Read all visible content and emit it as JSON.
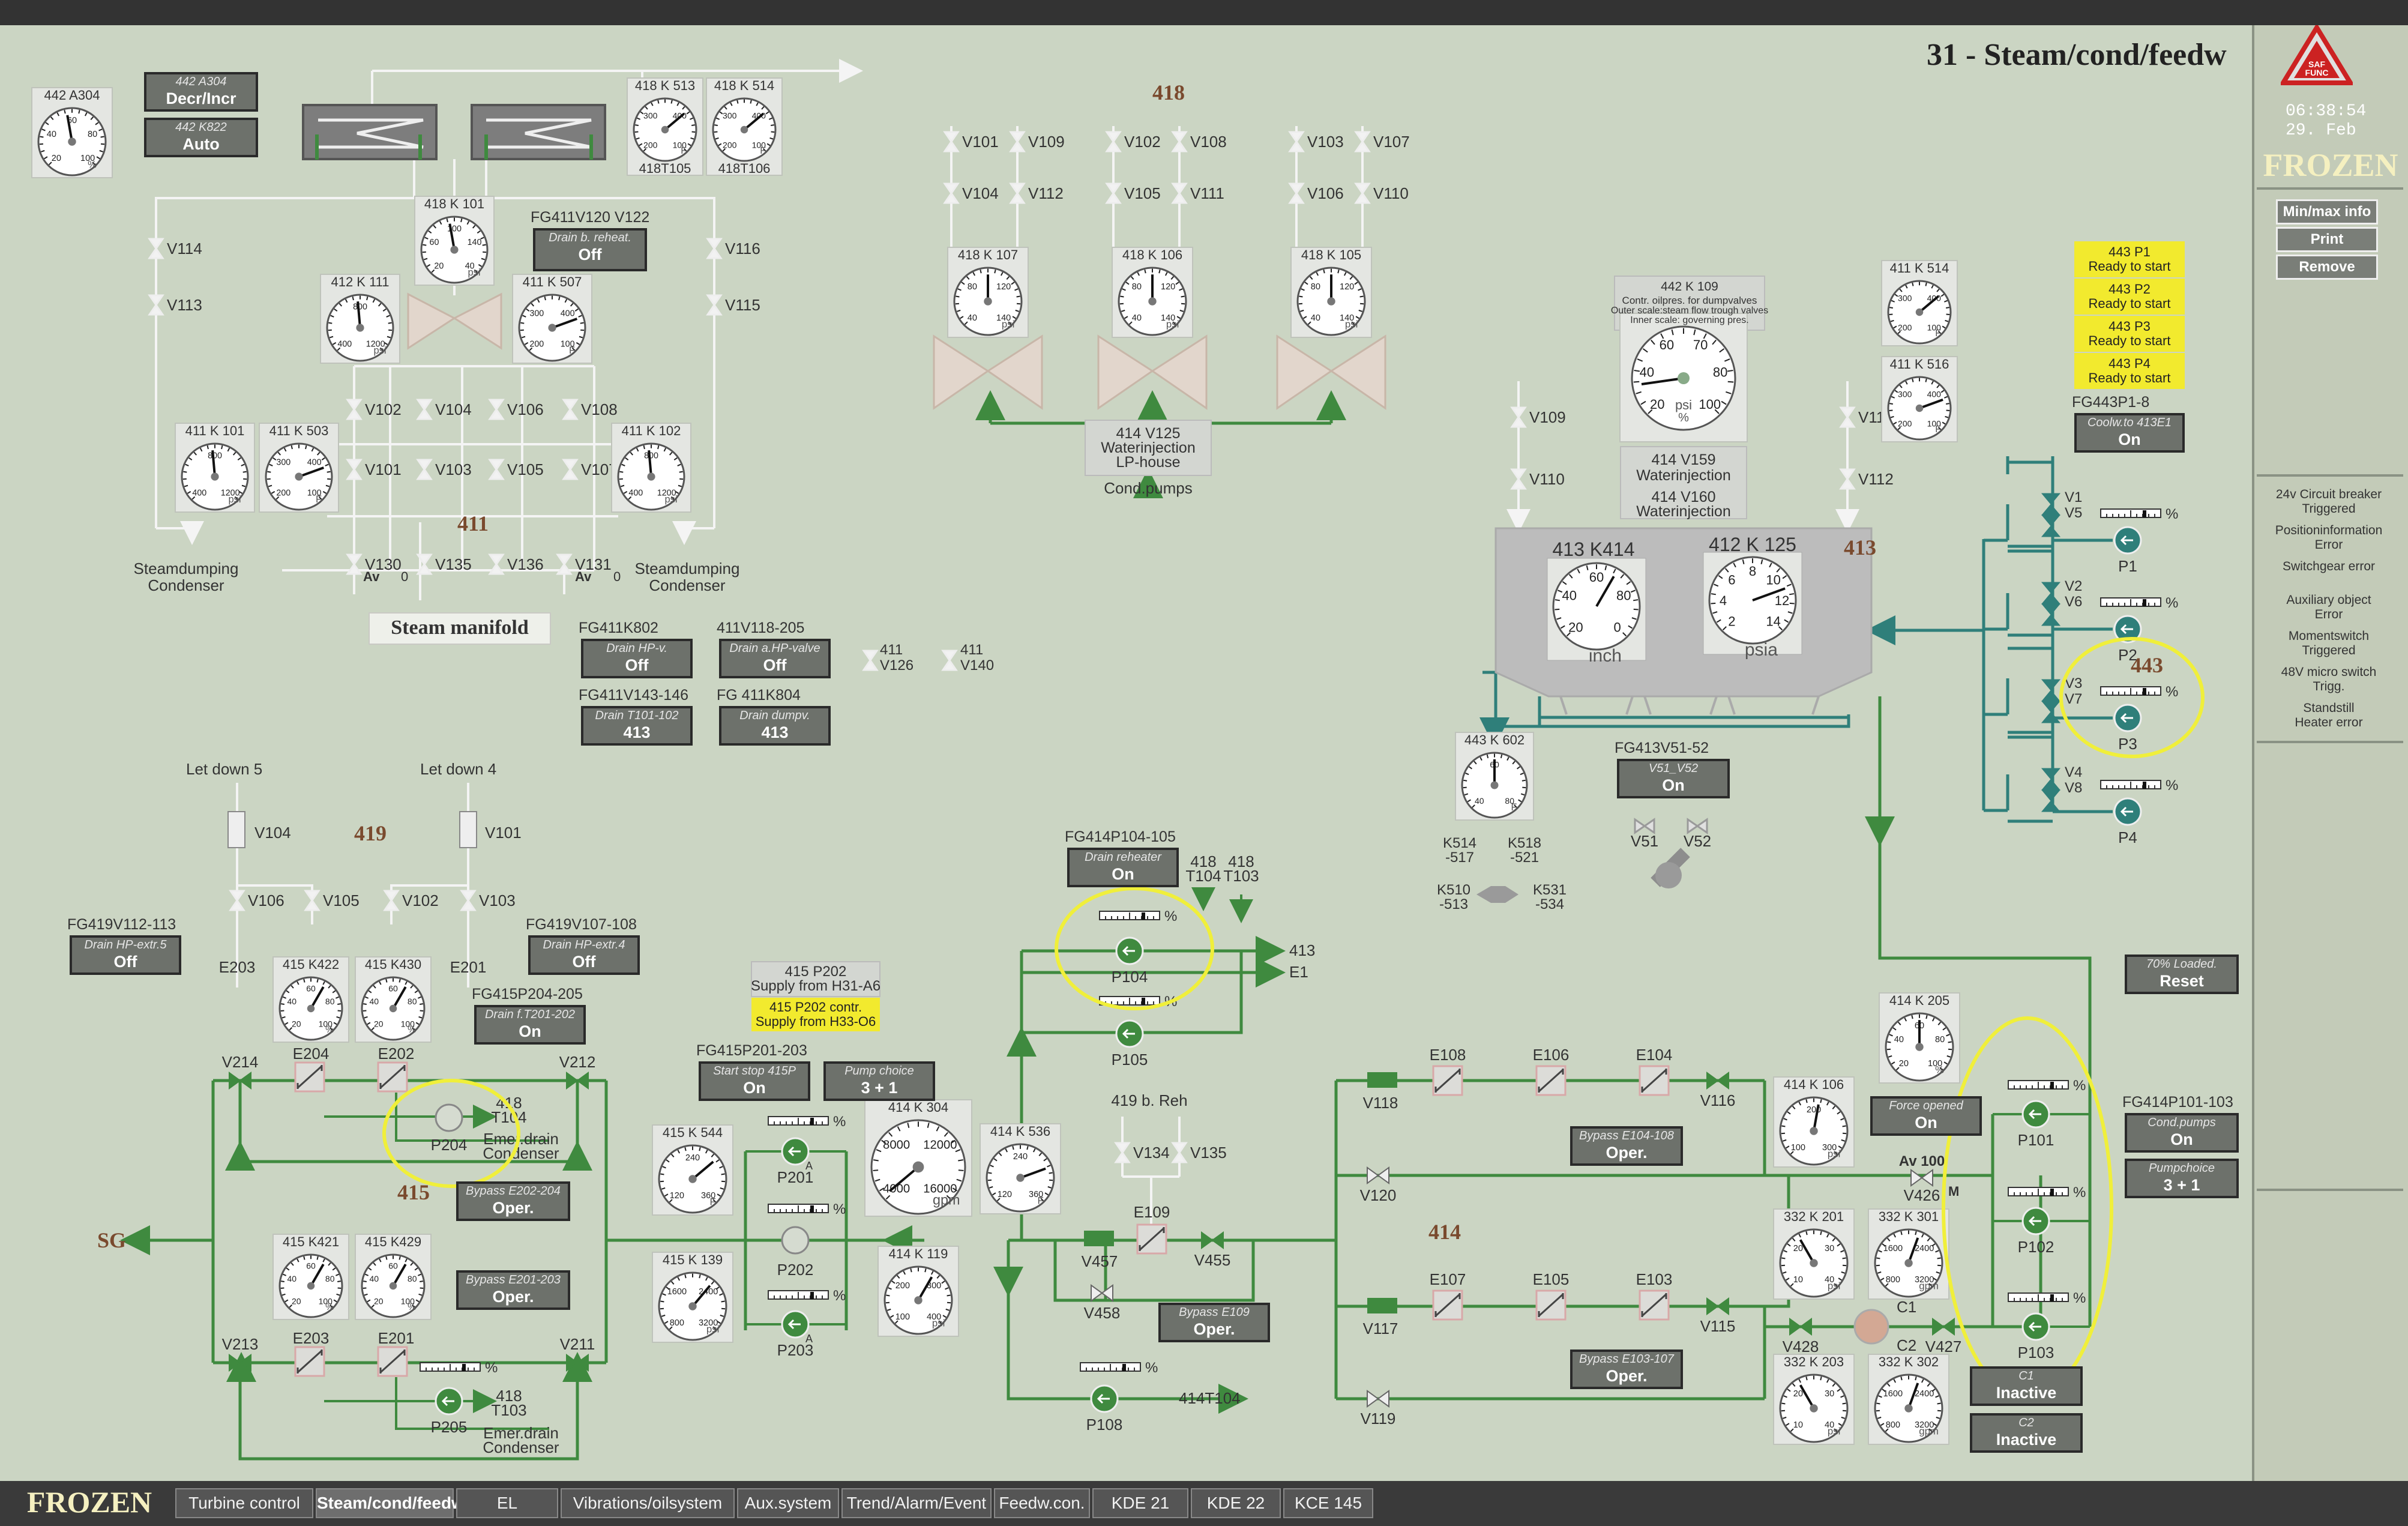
{
  "title": "31 - Steam/cond/feedw",
  "status": {
    "frozen": "FROZEN",
    "time": "06:38:54",
    "date": "29. Feb"
  },
  "safety_logo": {
    "text": "SAF FUNC"
  },
  "right_buttons": [
    "Min/max info",
    "Print",
    "Remove"
  ],
  "alarms": [
    {
      "line1": "24v Circuit breaker",
      "line2": "Triggered"
    },
    {
      "line1": "Positioninformation",
      "line2": "Error"
    },
    {
      "line1": "Switchgear error",
      "line2": ""
    },
    {
      "line1": "Auxiliary object",
      "line2": "Error"
    },
    {
      "line1": "Momentswitch",
      "line2": "Triggered"
    },
    {
      "line1": "48V micro switch",
      "line2": "Trigg."
    },
    {
      "line1": "Standstill",
      "line2": "Heater error"
    }
  ],
  "nav": {
    "frozen": "FROZEN",
    "tabs": [
      "Turbine control",
      "Steam/cond/feedw",
      "EL",
      "Vibrations/oilsystem",
      "Aux.system",
      "Trend/Alarm/Event",
      "Feedw.con.",
      "KDE 21",
      "KDE 22",
      "KCE 145"
    ],
    "active": "Steam/cond/feedw"
  },
  "areas": {
    "a418": "418",
    "a411": "411",
    "a413": "413",
    "a443": "443",
    "a419": "419",
    "a415": "415",
    "a414": "414"
  },
  "gauges": {
    "g442A304": {
      "tag": "442 A304",
      "unit": "%",
      "ticks": [
        "20",
        "40",
        "60",
        "80",
        "100"
      ]
    },
    "g418K513": {
      "tag": "418 K 513",
      "sub": "418T105",
      "unit": "F",
      "ticks": [
        "200",
        "300",
        "400",
        "100"
      ]
    },
    "g418K514": {
      "tag": "418 K 514",
      "sub": "418T106",
      "unit": "F",
      "ticks": [
        "200",
        "300",
        "400",
        "100"
      ]
    },
    "g418K101": {
      "tag": "418 K 101",
      "unit": "psi",
      "ticks": [
        "20",
        "60",
        "100",
        "140",
        "40"
      ]
    },
    "g412K111": {
      "tag": "412 K 111",
      "unit": "psi",
      "ticks": [
        "400",
        "800",
        "1200"
      ]
    },
    "g411K507": {
      "tag": "411 K 507",
      "unit": "F",
      "ticks": [
        "200",
        "300",
        "400",
        "100"
      ]
    },
    "g411K101": {
      "tag": "411 K 101",
      "unit": "psi",
      "ticks": [
        "400",
        "800",
        "1200"
      ]
    },
    "g411K503": {
      "tag": "411 K 503",
      "unit": "F",
      "ticks": [
        "200",
        "300",
        "400",
        "100"
      ]
    },
    "g411K102": {
      "tag": "411 K 102",
      "unit": "psi",
      "ticks": [
        "400",
        "800",
        "1200"
      ]
    },
    "g418K107": {
      "tag": "418 K 107",
      "unit": "psi",
      "ticks": [
        "40",
        "80",
        "120",
        "140"
      ]
    },
    "g418K106": {
      "tag": "418 K 106",
      "unit": "psi",
      "ticks": [
        "40",
        "80",
        "120",
        "140"
      ]
    },
    "g418K105": {
      "tag": "418 K 105",
      "unit": "psi",
      "ticks": [
        "40",
        "80",
        "120",
        "140"
      ]
    },
    "g442K109": {
      "tag": "442 K 109",
      "desc1": "Contr. oilpres. for dumpvalves",
      "desc2": "Outer scale:steam flow trough valves",
      "desc3": "Inner scale: governing pres.",
      "unit": "psi",
      "pct": "%",
      "ticks": [
        "20",
        "40",
        "60",
        "70",
        "80",
        "100"
      ]
    },
    "g411K514": {
      "tag": "411 K 514",
      "unit": "F",
      "ticks": [
        "200",
        "300",
        "400",
        "100"
      ]
    },
    "g411K516": {
      "tag": "411 K 516",
      "unit": "F",
      "ticks": [
        "200",
        "300",
        "400",
        "100"
      ]
    },
    "g413K414": {
      "tag": "413 K414",
      "unit": "inch",
      "ticks": [
        "20",
        "40",
        "60",
        "80",
        "0"
      ]
    },
    "g412K125": {
      "tag": "412 K 125",
      "unit": "psia",
      "ticks": [
        "2",
        "4",
        "6",
        "8",
        "10",
        "12",
        "14"
      ]
    },
    "g443K602": {
      "tag": "443 K 602",
      "unit": "F",
      "ticks": [
        "40",
        "60",
        "80"
      ]
    },
    "g415K422": {
      "tag": "415 K422",
      "unit": "%",
      "ticks": [
        "20",
        "40",
        "60",
        "80",
        "100"
      ]
    },
    "g415K430": {
      "tag": "415 K430",
      "unit": "%",
      "ticks": [
        "20",
        "40",
        "60",
        "80",
        "100"
      ]
    },
    "g415K421": {
      "tag": "415 K421",
      "unit": "%",
      "ticks": [
        "20",
        "40",
        "60",
        "80",
        "100"
      ]
    },
    "g415K429": {
      "tag": "415 K429",
      "unit": "%",
      "ticks": [
        "20",
        "40",
        "60",
        "80",
        "100"
      ]
    },
    "g415K544": {
      "tag": "415 K 544",
      "unit": "F",
      "ticks": [
        "120",
        "240",
        "360"
      ]
    },
    "g415K139": {
      "tag": "415 K 139",
      "unit": "psi",
      "ticks": [
        "800",
        "1600",
        "2400",
        "3200"
      ]
    },
    "g414K304": {
      "tag": "414 K 304",
      "unit": "gpm",
      "ticks": [
        "4000",
        "8000",
        "12000",
        "16000"
      ]
    },
    "g414K536": {
      "tag": "414 K 536",
      "unit": "F",
      "ticks": [
        "120",
        "240",
        "360"
      ]
    },
    "g414K119": {
      "tag": "414 K 119",
      "unit": "psi",
      "ticks": [
        "100",
        "200",
        "300",
        "400"
      ]
    },
    "g414K205": {
      "tag": "414 K 205",
      "unit": "%",
      "ticks": [
        "20",
        "40",
        "60",
        "80",
        "100"
      ]
    },
    "g414K106": {
      "tag": "414 K 106",
      "unit": "psi",
      "ticks": [
        "100",
        "200",
        "300"
      ]
    },
    "g332K201": {
      "tag": "332 K 201",
      "unit": "psi",
      "ticks": [
        "10",
        "20",
        "30",
        "40"
      ]
    },
    "g332K301": {
      "tag": "332 K 301",
      "unit": "gpm",
      "ticks": [
        "800",
        "1600",
        "2400",
        "3200"
      ]
    },
    "g332K203": {
      "tag": "332 K 203",
      "unit": "psi",
      "ticks": [
        "10",
        "20",
        "30",
        "40"
      ]
    },
    "g332K302": {
      "tag": "332 K 302",
      "unit": "gpm",
      "ticks": [
        "800",
        "1600",
        "2400",
        "3200"
      ]
    }
  },
  "panels": {
    "p442A304": {
      "title": "442 A304",
      "value": "Decr/Incr"
    },
    "p442K822": {
      "title": "442 K822",
      "value": "Auto"
    },
    "pFG411V120": {
      "label": "FG411V120 V122",
      "title": "Drain b. reheat.",
      "value": "Off"
    },
    "pFG411K802": {
      "label": "FG411K802",
      "title": "Drain HP-v.",
      "value": "Off"
    },
    "p411V118": {
      "label": "411V118-205",
      "title": "Drain a.HP-valve",
      "value": "Off"
    },
    "pFG411V143": {
      "label": "FG411V143-146",
      "title": "Drain T101-102",
      "value": "413"
    },
    "pFG411K804": {
      "label": "FG 411K804",
      "title": "Drain dumpv.",
      "value": "413"
    },
    "pFG443P1": {
      "label": "FG443P1-8",
      "title": "Coolw.to 413E1",
      "value": "On"
    },
    "pFG413V51": {
      "label": "FG413V51-52",
      "title": "V51_V52",
      "value": "On"
    },
    "pFG414P104": {
      "label": "FG414P104-105",
      "title": "Drain reheater",
      "value": "On"
    },
    "pFG419V112": {
      "label": "FG419V112-113",
      "title": "Drain HP-extr.5",
      "value": "Off"
    },
    "pFG419V107": {
      "label": "FG419V107-108",
      "title": "Drain HP-extr.4",
      "value": "Off"
    },
    "pFG415P204": {
      "label": "FG415P204-205",
      "title": "Drain f.T201-202",
      "value": "On"
    },
    "pFG415P201": {
      "label": "FG415P201-203",
      "title": "Start stop 415P",
      "value": "On"
    },
    "pPumpChoice": {
      "title": "Pump choice",
      "value": "3 + 1"
    },
    "pBypassE202": {
      "title": "Bypass E202-204",
      "value": "Oper."
    },
    "pBypassE201": {
      "title": "Bypass E201-203",
      "value": "Oper."
    },
    "pBypassE104": {
      "title": "Bypass E104-108",
      "value": "Oper."
    },
    "pBypassE109": {
      "title": "Bypass E109",
      "value": "Oper."
    },
    "pBypassE103": {
      "title": "Bypass E103-107",
      "value": "Oper."
    },
    "pForceOpened": {
      "title": "Force opened",
      "value": "On"
    },
    "p70Loaded": {
      "title": "70% Loaded.",
      "value": "Reset"
    },
    "pFG414P101": {
      "label": "FG414P101-103",
      "title": "Cond.pumps",
      "value": "On"
    },
    "pPumpchoice2": {
      "title": "Pumpchoice",
      "value": "3 + 1"
    },
    "pC1": {
      "title": "C1",
      "value": "Inactive"
    },
    "pC2": {
      "title": "C2",
      "value": "Inactive"
    }
  },
  "yellow": {
    "p443": [
      {
        "l1": "443 P1",
        "l2": "Ready to start"
      },
      {
        "l1": "443 P2",
        "l2": "Ready to start"
      },
      {
        "l1": "443 P3",
        "l2": "Ready to start"
      },
      {
        "l1": "443 P4",
        "l2": "Ready to start"
      }
    ],
    "p415P202": {
      "l1": "415 P202 contr.",
      "l2": "Supply from H33-O6"
    }
  },
  "texts": {
    "p415P202_head1": "415 P202",
    "p415P202_head2": "Supply from H31-A6",
    "v414V125_1": "414 V125",
    "v414V125_2": "Waterinjection",
    "v414V125_3": "LP-house",
    "condpumps": "Cond.pumps",
    "v414V159_1": "414 V159",
    "v414V159_2": "Waterinjection",
    "v414V160_1": "414 V160",
    "v414V160_2": "Waterinjection",
    "steamdumping": "Steamdumping",
    "condenser": "Condenser",
    "steammanifold": "Steam manifold",
    "letdown5": "Let down    5",
    "letdown4": "Let down    4",
    "sg": "SG",
    "reh419": "419 b. Reh",
    "emerdrain": "Emer.drain",
    "av100": "Av 100",
    "M": "M",
    "t418T104": "418",
    "t418T104b": "T104",
    "t418T103": "418",
    "t418T103b": "T103",
    "t413": "413",
    "tE1": "E1",
    "t414T104": "414T104",
    "tAv": "Av",
    "t0": "0",
    "t411": "411"
  },
  "valves": [
    "V101",
    "V109",
    "V102",
    "V108",
    "V103",
    "V107",
    "V104",
    "V112",
    "V105",
    "V111",
    "V106",
    "V110",
    "V114",
    "V113",
    "V116",
    "V115",
    "V102",
    "V104",
    "V106",
    "V108",
    "V101",
    "V103",
    "V105",
    "V107",
    "V130",
    "V135",
    "V136",
    "V131",
    "V126",
    "V140",
    "V109",
    "V110",
    "V111",
    "V112",
    "V1",
    "V5",
    "V2",
    "V6",
    "V3",
    "V7",
    "V4",
    "V8",
    "V51",
    "V52",
    "K514",
    "-517",
    "K518",
    "-521",
    "K510",
    "-513",
    "K531",
    "-534",
    "V104",
    "V101",
    "V106",
    "V105",
    "V102",
    "V103",
    "E203",
    "E201",
    "V214",
    "E204",
    "E202",
    "V212",
    "V213",
    "E203",
    "E201",
    "V211",
    "P204",
    "P205",
    "P201",
    "P202",
    "P203",
    "P104",
    "P105",
    "P108",
    "V134",
    "V135",
    "E109",
    "V457",
    "V455",
    "V458",
    "V118",
    "E108",
    "E106",
    "E104",
    "V116",
    "V120",
    "V426",
    "V117",
    "E107",
    "E105",
    "E103",
    "V115",
    "V119",
    "V428",
    "C1",
    "C2",
    "V427",
    "P101",
    "P102",
    "P103",
    "P1",
    "P2",
    "P3",
    "P4"
  ],
  "colors": {
    "pipe_green": "#3f8a3f",
    "pipe_teal": "#2f7f7a",
    "bg": "#cbd5c3",
    "nav_bg": "#3a3a3a",
    "yellow": "#f2ea2e",
    "highlight": "#f0ef3a",
    "title_color": "#222222",
    "frozen_color": "#f5f0c0"
  }
}
